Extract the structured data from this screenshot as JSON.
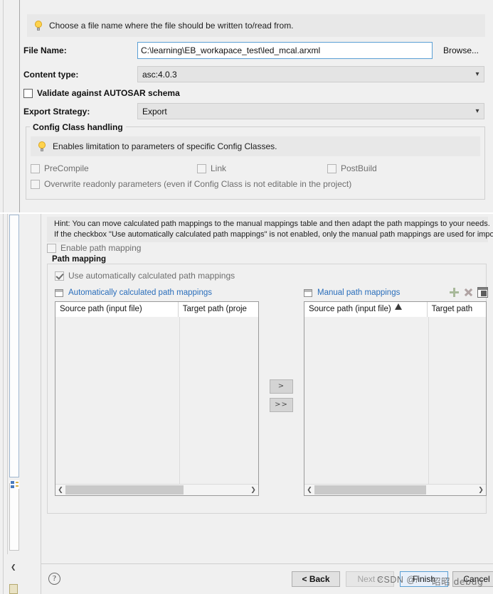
{
  "dialog": {
    "hint_banner": "Choose a file name where the file should be written to/read from.",
    "file_name_label": "File Name:",
    "file_name_value": "C:\\learning\\EB_workapace_test\\led_mcal.arxml",
    "browse_label": "Browse...",
    "content_type_label": "Content type:",
    "content_type_value": "asc:4.0.3",
    "validate_checkbox_label": "Validate against AUTOSAR schema",
    "export_strategy_label": "Export Strategy:",
    "export_strategy_value": "Export",
    "config_class": {
      "group_title": "Config Class handling",
      "hint": "Enables limitation to parameters of specific Config Classes.",
      "precompile_label": "PreCompile",
      "link_label": "Link",
      "postbuild_label": "PostBuild",
      "overwrite_label": "Overwrite readonly parameters (even if Config Class is not editable in the project)"
    }
  },
  "path_page": {
    "hint_line1": "Hint: You can move calculated path mappings to the manual mappings table and then adapt the path mappings to your needs.",
    "hint_line2": "If the checkbox \"Use automatically calculated path mappings\" is not enabled, only the manual path mappings are used for import.",
    "enable_path_mapping_label": "Enable path mapping",
    "group_title": "Path mapping",
    "use_auto_label": "Use automatically calculated path mappings",
    "auto_table": {
      "caption": "Automatically calculated path mappings",
      "columns": [
        "Source path (input file)",
        "Target path (proje"
      ],
      "rows": []
    },
    "manual_table": {
      "caption": "Manual path mappings",
      "columns": [
        "Source path (input file)",
        "Target path"
      ],
      "rows": []
    },
    "transfer_single_label": ">",
    "transfer_all_label": ">>",
    "toolbar_icons": [
      "add-icon",
      "delete-icon",
      "edit-icon"
    ]
  },
  "footer": {
    "help_label": "?",
    "back_label": "< Back",
    "next_label": "Next >",
    "finish_label": "Finish",
    "cancel_label": "Cancel"
  },
  "watermark": {
    "left": "CSDN @/",
    "right": "昭昭 debug"
  }
}
